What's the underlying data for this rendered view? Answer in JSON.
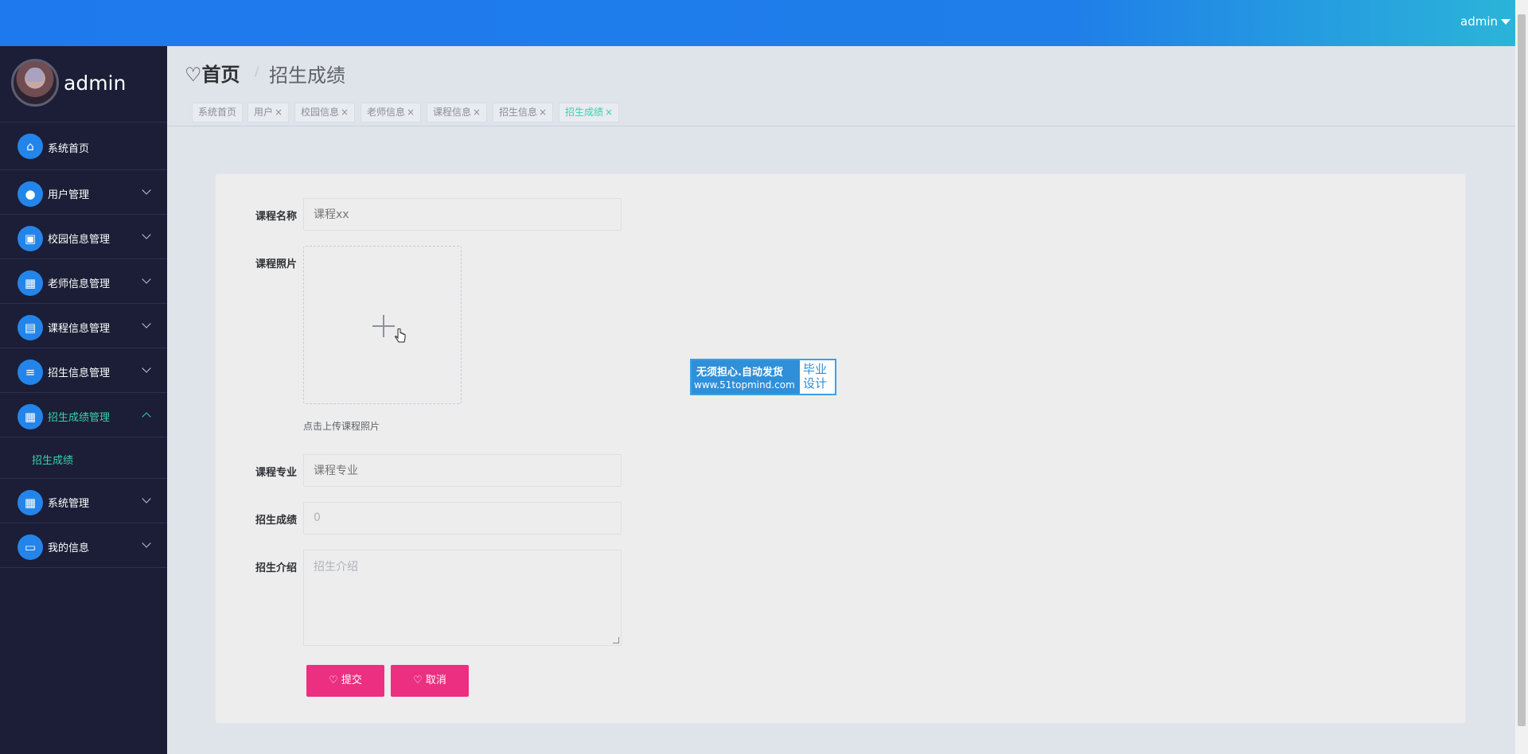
{
  "topbar": {
    "user": "admin"
  },
  "sidebar": {
    "profile_name": "admin",
    "items": [
      {
        "label": "系统首页",
        "icon": "home-icon"
      },
      {
        "label": "用户管理",
        "icon": "bulb-icon"
      },
      {
        "label": "校园信息管理",
        "icon": "clipboard-icon"
      },
      {
        "label": "老师信息管理",
        "icon": "grid-icon"
      },
      {
        "label": "课程信息管理",
        "icon": "briefcase-icon"
      },
      {
        "label": "招生信息管理",
        "icon": "list-icon"
      },
      {
        "label": "招生成绩管理",
        "icon": "grid-icon"
      },
      {
        "label": "系统管理",
        "icon": "grid-icon"
      },
      {
        "label": "我的信息",
        "icon": "card-icon"
      }
    ],
    "submenu_label": "招生成绩"
  },
  "breadcrumb": {
    "home": "首页",
    "separator": "/",
    "current": "招生成绩"
  },
  "tags": [
    "系统首页",
    "用户",
    "校园信息",
    "老师信息",
    "课程信息",
    "招生信息",
    "招生成绩"
  ],
  "form": {
    "course_name_label": "课程名称",
    "course_name_placeholder": "课程xx",
    "course_photo_label": "课程照片",
    "upload_hint": "点击上传课程照片",
    "course_major_label": "课程专业",
    "course_major_placeholder": "课程专业",
    "score_label": "招生成绩",
    "score_value": "0",
    "intro_label": "招生介绍",
    "intro_placeholder": "招生介绍",
    "submit_label": "提交",
    "cancel_label": "取消"
  },
  "watermark": {
    "line1": "无须担心.自动发货",
    "line2": "www.51topmind.com",
    "right": "毕业设计"
  },
  "colors": {
    "accent": "#2385ea",
    "active_text": "#3dd0b0",
    "button": "#ec2f81",
    "sidebar_bg": "#1b1e36"
  }
}
